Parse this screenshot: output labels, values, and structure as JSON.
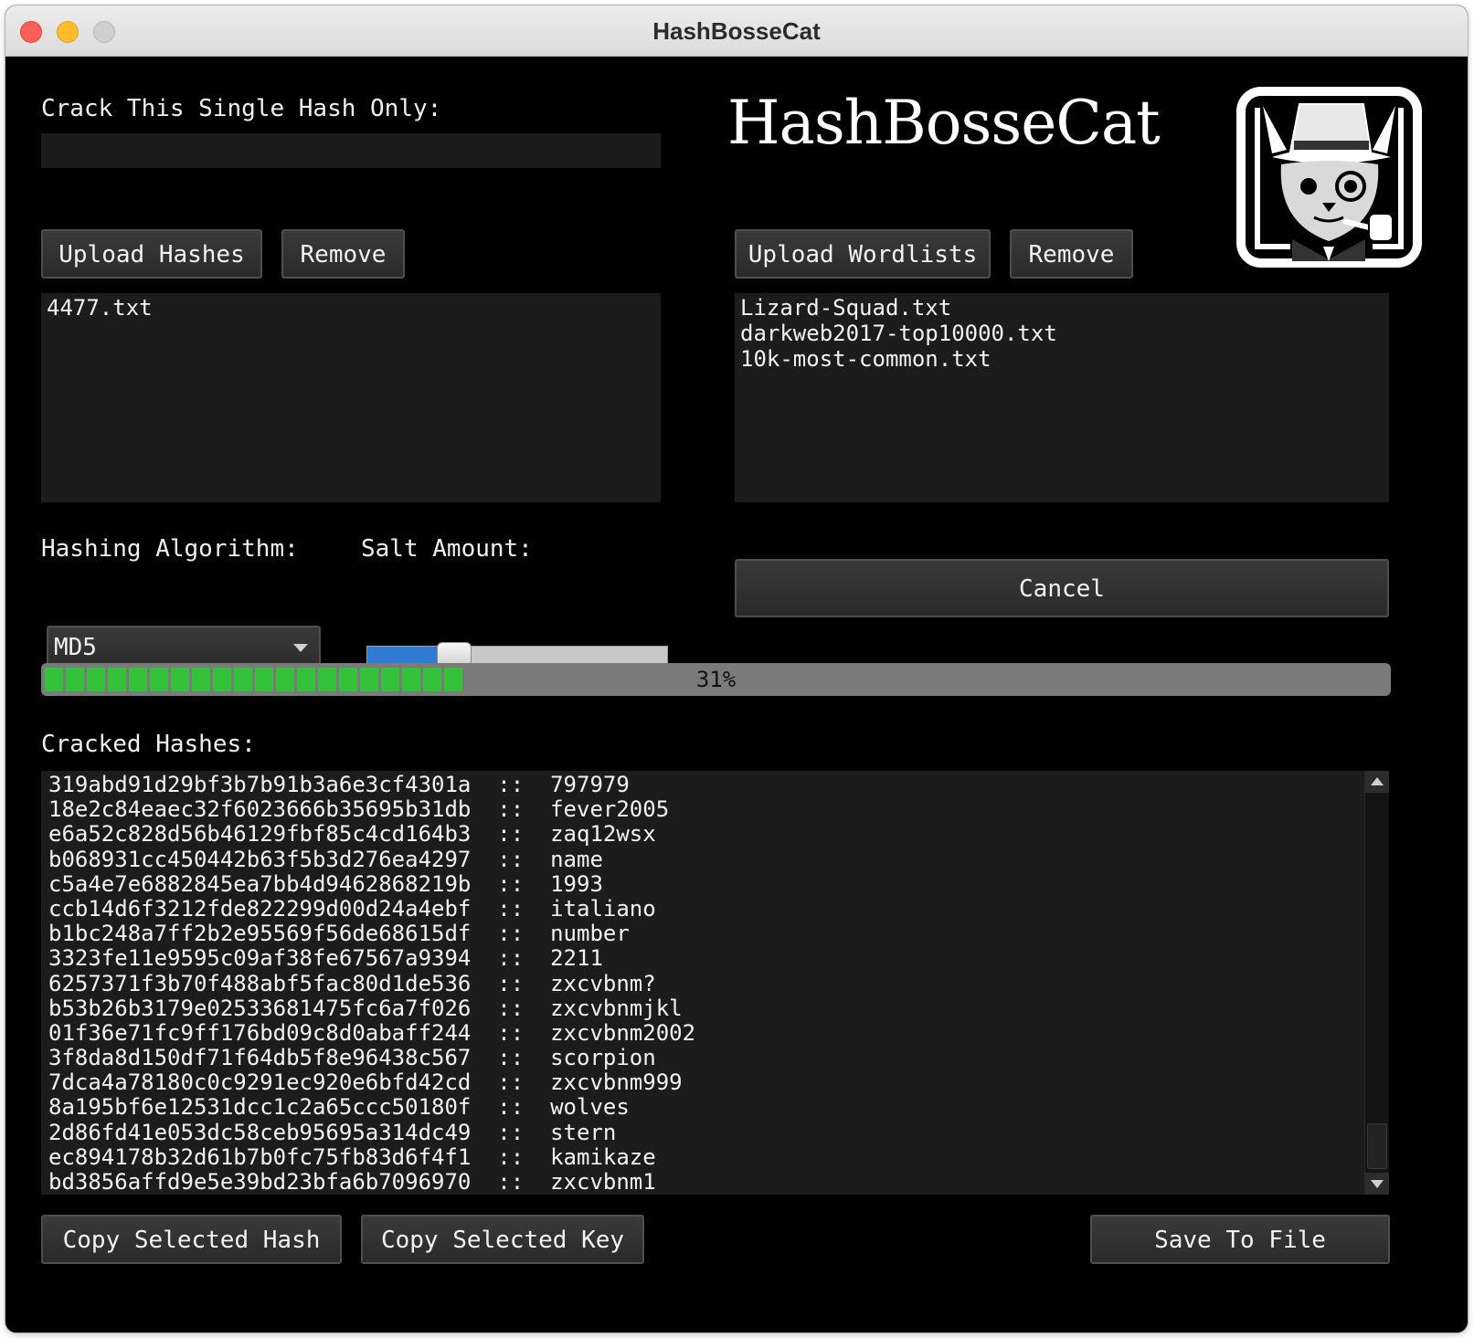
{
  "window": {
    "title": "HashBosseCat"
  },
  "single_hash": {
    "label": "Crack This Single Hash Only:",
    "value": ""
  },
  "hashes": {
    "upload_label": "Upload Hashes",
    "remove_label": "Remove",
    "files": [
      "4477.txt"
    ]
  },
  "brand": {
    "name": "HashBosseCat",
    "logo_icon": "detective-cat-logo-icon"
  },
  "wordlists": {
    "upload_label": "Upload Wordlists",
    "remove_label": "Remove",
    "files": [
      "Lizard-Squad.txt",
      "darkweb2017-top10000.txt",
      "10k-most-common.txt"
    ]
  },
  "algorithm": {
    "label": "Hashing Algorithm:",
    "selected": "MD5"
  },
  "salt": {
    "label": "Salt Amount:",
    "level": 0.26
  },
  "actions": {
    "cancel_label": "Cancel"
  },
  "progress": {
    "percent": 31,
    "text": "31%",
    "color": "#33c23a"
  },
  "cracked": {
    "label": "Cracked Hashes:",
    "separator": "::",
    "rows": [
      {
        "hash": "319abd91d29bf3b7b91b3a6e3cf4301a",
        "key": "797979"
      },
      {
        "hash": "18e2c84eaec32f6023666b35695b31db",
        "key": "fever2005"
      },
      {
        "hash": "e6a52c828d56b46129fbf85c4cd164b3",
        "key": "zaq12wsx"
      },
      {
        "hash": "b068931cc450442b63f5b3d276ea4297",
        "key": "name"
      },
      {
        "hash": "c5a4e7e6882845ea7bb4d9462868219b",
        "key": "1993"
      },
      {
        "hash": "ccb14d6f3212fde822299d00d24a4ebf",
        "key": "italiano"
      },
      {
        "hash": "b1bc248a7ff2b2e95569f56de68615df",
        "key": "number"
      },
      {
        "hash": "3323fe11e9595c09af38fe67567a9394",
        "key": "2211"
      },
      {
        "hash": "6257371f3b70f488abf5fac80d1de536",
        "key": "zxcvbnm?"
      },
      {
        "hash": "b53b26b3179e02533681475fc6a7f026",
        "key": "zxcvbnmjkl"
      },
      {
        "hash": "01f36e71fc9ff176bd09c8d0abaff244",
        "key": "zxcvbnm2002"
      },
      {
        "hash": "3f8da8d150df71f64db5f8e96438c567",
        "key": "scorpion"
      },
      {
        "hash": "7dca4a78180c0c9291ec920e6bfd42cd",
        "key": "zxcvbnm999"
      },
      {
        "hash": "8a195bf6e12531dcc1c2a65ccc50180f",
        "key": "wolves"
      },
      {
        "hash": "2d86fd41e053dc58ceb95695a314dc49",
        "key": "stern"
      },
      {
        "hash": "ec894178b32d61b7b0fc75fb83d6f4f1",
        "key": "kamikaze"
      },
      {
        "hash": "bd3856affd9e5e39bd23bfa6b7096970",
        "key": "zxcvbnm1"
      }
    ]
  },
  "footer": {
    "copy_hash_label": "Copy Selected Hash",
    "copy_key_label": "Copy Selected Key",
    "save_label": "Save To File"
  }
}
